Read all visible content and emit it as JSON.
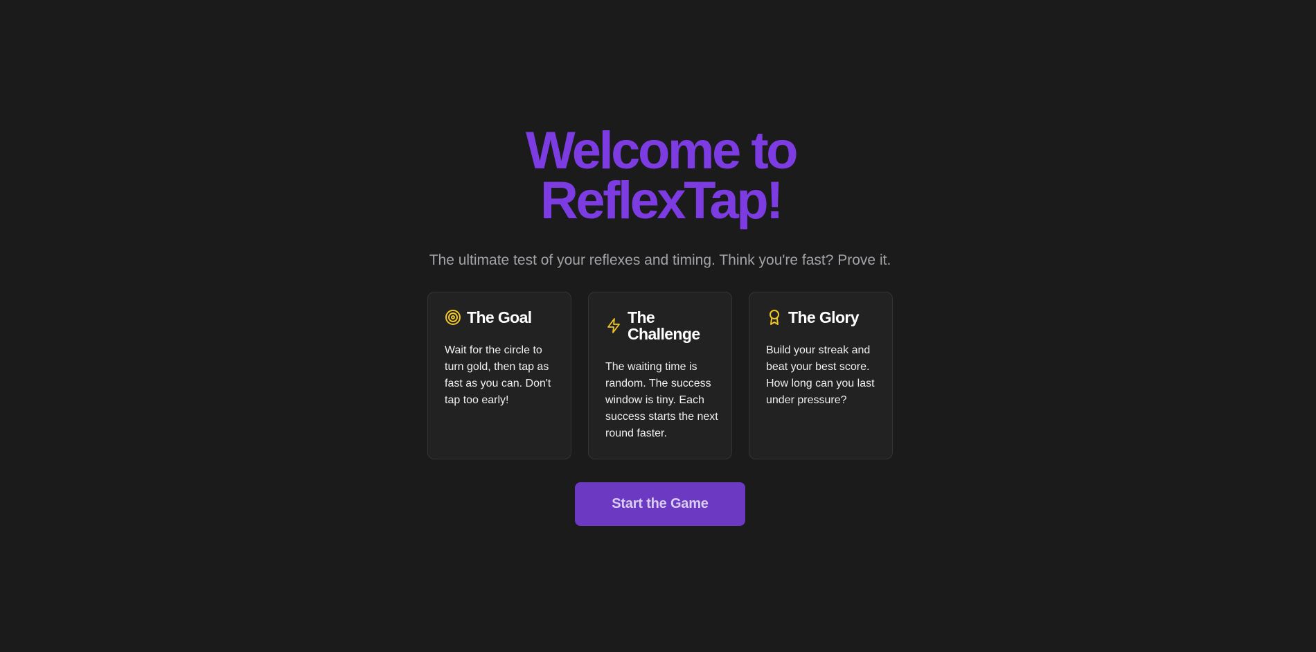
{
  "hero": {
    "title_line1": "Welcome to",
    "title_line2": "ReflexTap!",
    "subtitle": "The ultimate test of your reflexes and timing. Think you're fast? Prove it."
  },
  "cards": [
    {
      "icon": "target-icon",
      "title": "The Goal",
      "text": "Wait for the circle to turn gold, then tap as fast as you can. Don't tap too early!"
    },
    {
      "icon": "lightning-icon",
      "title": "The Challenge",
      "text": "The waiting time is random. The success window is tiny. Each success starts the next round faster."
    },
    {
      "icon": "award-ribbon-icon",
      "title": "The Glory",
      "text": "Build your streak and beat your best score. How long can you last under pressure?"
    }
  ],
  "start_button": {
    "label": "Start the Game"
  },
  "colors": {
    "background": "#1b1b1c",
    "accent_purple": "#7d3ce2",
    "button_purple": "#6b39c2",
    "icon_gold": "#f2c623",
    "card_bg": "#222223"
  }
}
